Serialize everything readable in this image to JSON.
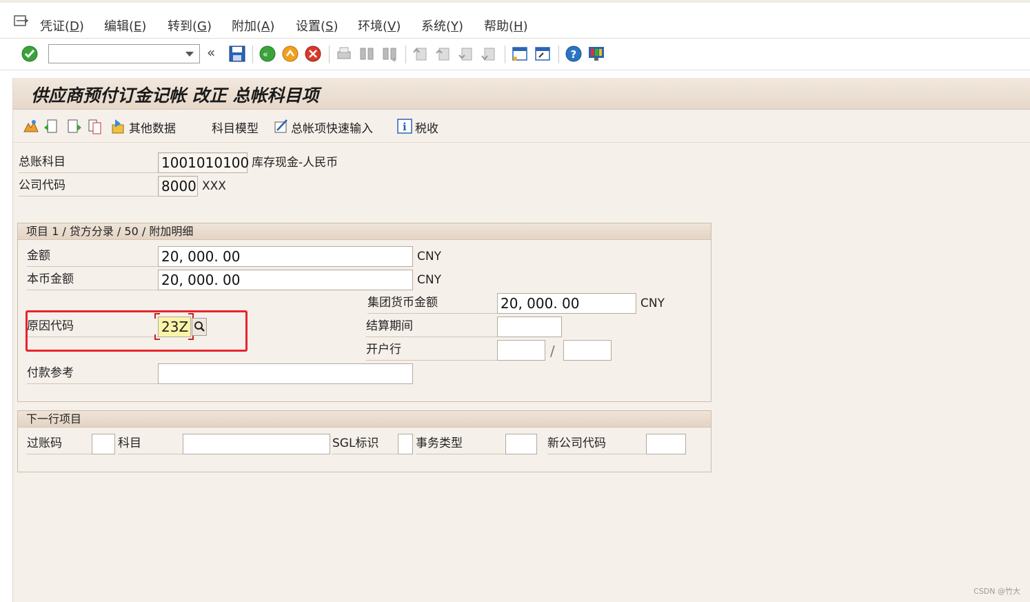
{
  "menu": {
    "items": [
      {
        "label": "凭证(",
        "key": "D",
        "tail": ")"
      },
      {
        "label": "编辑(",
        "key": "E",
        "tail": ")"
      },
      {
        "label": "转到(",
        "key": "G",
        "tail": ")"
      },
      {
        "label": "附加(",
        "key": "A",
        "tail": ")"
      },
      {
        "label": "设置(",
        "key": "S",
        "tail": ")"
      },
      {
        "label": "环境(",
        "key": "V",
        "tail": ")"
      },
      {
        "label": "系统(",
        "key": "Y",
        "tail": ")"
      },
      {
        "label": "帮助(",
        "key": "H",
        "tail": ")"
      }
    ]
  },
  "toolbar": {
    "command_value": "",
    "back_glyph": "«"
  },
  "screen": {
    "title": "供应商预付订金记帐 改正 总帐科目项",
    "app_toolbar": {
      "other_data": "其他数据",
      "account_model": "科目模型",
      "gl_fast_entry": "总帐项快速输入",
      "tax": "税收"
    },
    "header": {
      "gl_account_label": "总账科目",
      "gl_account_value": "1001010100",
      "gl_account_desc": "库存现金-人民币",
      "company_code_label": "公司代码",
      "company_code_value": "8000",
      "company_code_desc": "XXX"
    },
    "item_group": {
      "title": "项目 1 / 贷方分录 / 50 / 附加明细",
      "amount_label": "金额",
      "amount_value": "20, 000. 00",
      "amount_currency": "CNY",
      "local_amount_label": "本币金额",
      "local_amount_value": "20, 000. 00",
      "local_amount_currency": "CNY",
      "group_amount_label": "集团货币金额",
      "group_amount_value": "20, 000. 00",
      "group_amount_currency": "CNY",
      "reason_code_label": "原因代码",
      "reason_code_value": "23Z",
      "settlement_period_label": "结算期间",
      "settlement_period_value": "",
      "bank_label": "开户行",
      "bank_value1": "",
      "bank_separator": "/",
      "bank_value2": "",
      "payment_ref_label": "付款参考",
      "payment_ref_value": ""
    },
    "next_line": {
      "title": "下一行项目",
      "posting_key_label": "过账码",
      "posting_key_value": "",
      "account_label": "科目",
      "account_value": "",
      "sgl_label": "SGL标识",
      "sgl_value": "",
      "trans_type_label": "事务类型",
      "trans_type_value": "",
      "new_company_label": "新公司代码",
      "new_company_value": ""
    }
  },
  "watermark": "CSDN @竹大",
  "colors": {
    "highlight": "#e8232a",
    "reason_bg": "#fbf3a8",
    "screen_bg": "#f6f0ea"
  }
}
